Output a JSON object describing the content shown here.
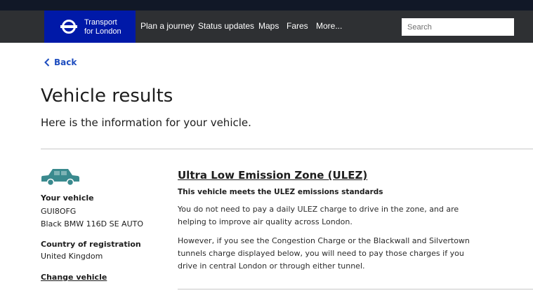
{
  "header": {
    "logo_line1": "Transport",
    "logo_line2": "for London",
    "nav": [
      "Plan a journey",
      "Status updates",
      "Maps",
      "Fares",
      "More..."
    ],
    "search_placeholder": "Search"
  },
  "page": {
    "back_label": "Back",
    "title": "Vehicle results",
    "subtitle": "Here is the information for your vehicle."
  },
  "vehicle": {
    "your_vehicle_label": "Your vehicle",
    "registration": "GUI8OFG",
    "description": "Black BMW 116D SE AUTO",
    "country_label": "Country of registration",
    "country": "United Kingdom",
    "change_label": "Change vehicle"
  },
  "ulez": {
    "title": "Ultra Low Emission Zone (ULEZ)",
    "status": "This vehicle meets the ULEZ emissions standards",
    "para1": "You do not need to pay a daily ULEZ charge to drive in the zone, and are helping to improve air quality across London.",
    "para2": "However, if you see the Congestion Charge or the Blackwall and Silvertown tunnels charge displayed below, you will need to pay those charges if you drive in central London or through either tunnel."
  },
  "colors": {
    "brand_blue": "#0019a8",
    "header_dark": "#2e3033",
    "link_blue": "#1e4dbf",
    "car_teal": "#3a8a8e"
  }
}
